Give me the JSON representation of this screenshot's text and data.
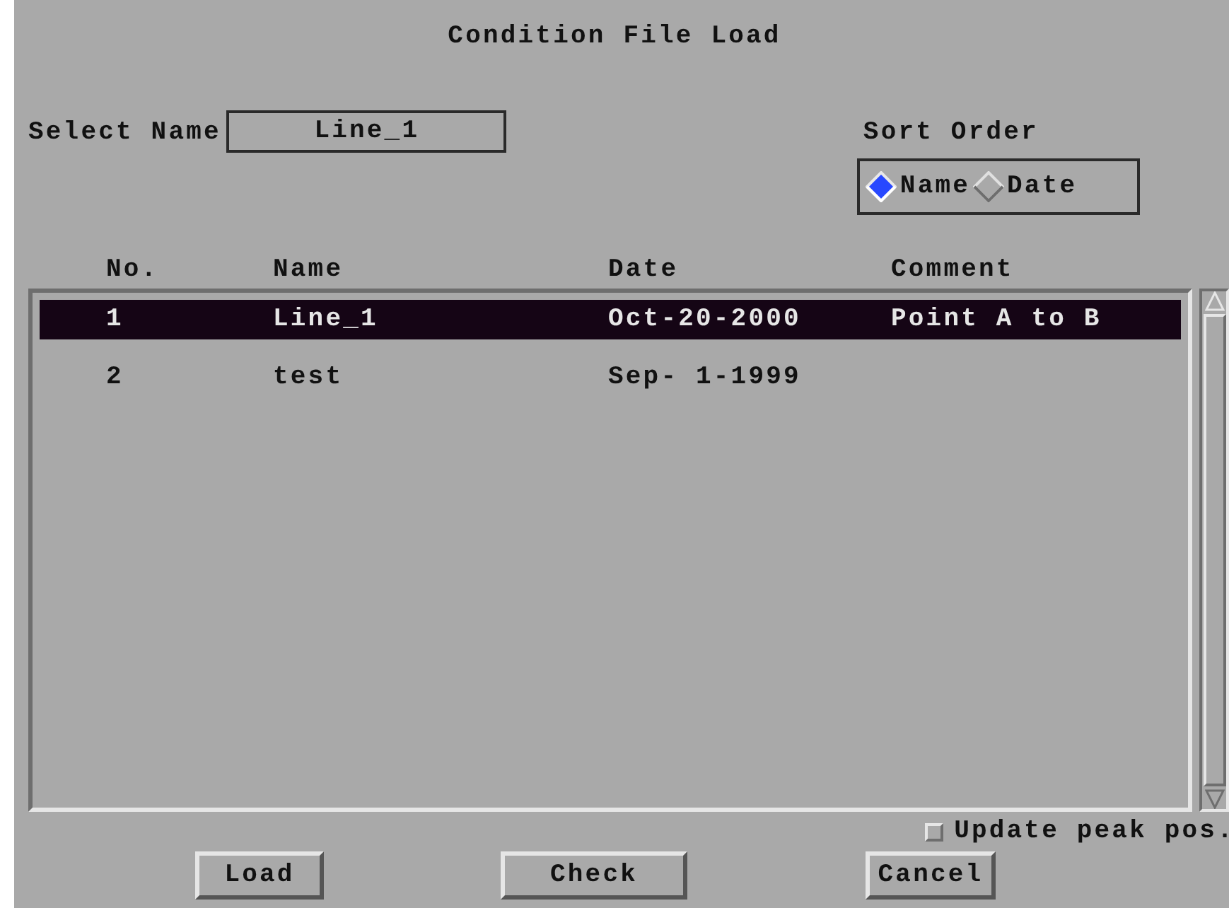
{
  "window": {
    "title": "Condition File Load"
  },
  "select_name": {
    "label": "Select Name",
    "value": "Line_1"
  },
  "sort_order": {
    "label": "Sort Order",
    "options": [
      {
        "label": "Name",
        "selected": true
      },
      {
        "label": "Date",
        "selected": false
      }
    ]
  },
  "table": {
    "columns": [
      "No.",
      "Name",
      "Date",
      "Comment"
    ],
    "rows": [
      {
        "cells": [
          "1",
          "Line_1",
          "Oct-20-2000",
          "Point A to B"
        ],
        "selected": true
      },
      {
        "cells": [
          "2",
          "test",
          "Sep- 1-1999"
        ],
        "selected": false
      }
    ]
  },
  "update_peak_pos": {
    "label": "Update peak pos.",
    "checked": false
  },
  "buttons": [
    "Load",
    "Check",
    "Cancel"
  ]
}
